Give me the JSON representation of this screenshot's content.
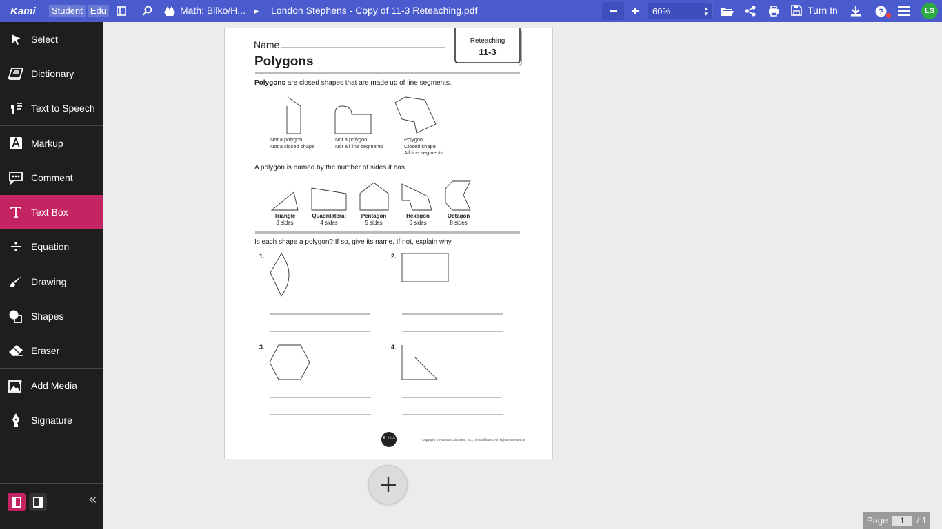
{
  "topbar": {
    "logo": "Kami",
    "pill_student": "Student",
    "pill_edu": "Edu",
    "breadcrumb": "Math: Bilko/H...",
    "doc_title": "London Stephens - Copy of 11-3 Reteaching.pdf",
    "zoom": "60%",
    "turn_in": "Turn In",
    "avatar": "LS"
  },
  "sidebar": {
    "items": [
      {
        "label": "Select",
        "icon": "cursor-icon"
      },
      {
        "label": "Dictionary",
        "icon": "book-icon"
      },
      {
        "label": "Text to Speech",
        "icon": "speech-icon"
      },
      {
        "label": "Markup",
        "icon": "markup-icon"
      },
      {
        "label": "Comment",
        "icon": "comment-icon"
      },
      {
        "label": "Text Box",
        "icon": "textbox-icon"
      },
      {
        "label": "Equation",
        "icon": "divide-icon"
      },
      {
        "label": "Drawing",
        "icon": "brush-icon"
      },
      {
        "label": "Shapes",
        "icon": "shapes-icon"
      },
      {
        "label": "Eraser",
        "icon": "eraser-icon"
      },
      {
        "label": "Add Media",
        "icon": "image-icon"
      },
      {
        "label": "Signature",
        "icon": "pen-icon"
      }
    ],
    "active": "Text Box",
    "accent": "#c42562"
  },
  "worksheet": {
    "name_label": "Name",
    "tab_label": "Reteaching",
    "tab_number": "11-3",
    "title": "Polygons",
    "intro_bold": "Polygons",
    "intro_rest": " are closed shapes that are made up of line segments.",
    "examples": [
      {
        "lines": [
          "Not a polygon",
          "Not a closed shape"
        ]
      },
      {
        "lines": [
          "Not a polygon",
          "Not all line segments"
        ]
      },
      {
        "lines": [
          "Polygon",
          "Closed shape",
          "All line segments"
        ]
      }
    ],
    "named_line": "A polygon is named by the number of sides it has.",
    "shapes": [
      {
        "name": "Triangle",
        "sides": "3 sides"
      },
      {
        "name": "Quadrilateral",
        "sides": "4 sides"
      },
      {
        "name": "Pentagon",
        "sides": "5 sides"
      },
      {
        "name": "Hexagon",
        "sides": "6 sides"
      },
      {
        "name": "Octagon",
        "sides": "8 sides"
      }
    ],
    "question": "Is each shape a polygon? If so, give its name. If not, explain why.",
    "q_numbers": [
      "1.",
      "2.",
      "3.",
      "4."
    ],
    "footer_badge": "R 11-3",
    "copyright": "Copyright © Pearson Education, Inc., or its affiliates. All Rights Reserved.  8"
  },
  "pager": {
    "label": "Page",
    "current": "1",
    "total": "/ 1"
  },
  "colors": {
    "topbar": "#4a5bcd",
    "sidebar": "#1e1e1e",
    "avatar": "#2eaa43"
  }
}
